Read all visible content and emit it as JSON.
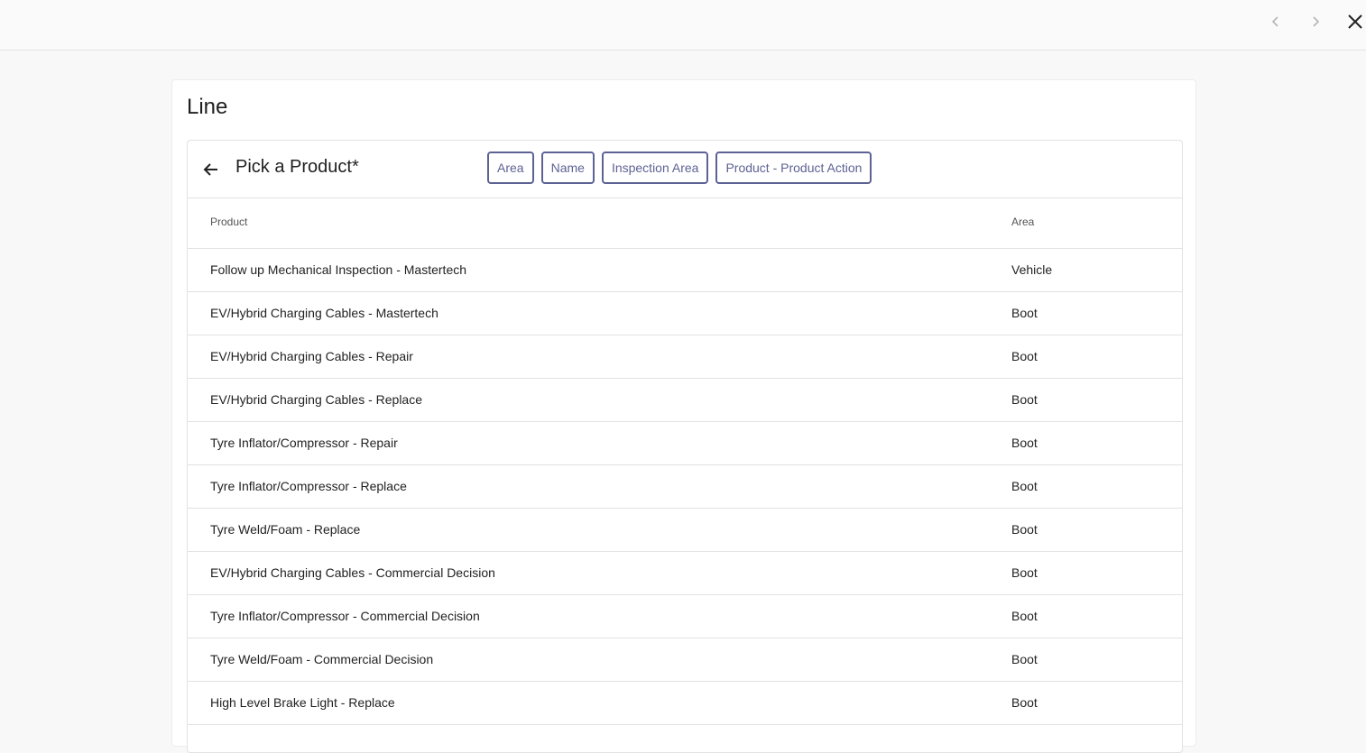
{
  "top_nav": {
    "prev_icon": "chevron-left-icon",
    "next_icon": "chevron-right-icon",
    "close_icon": "close-icon"
  },
  "card": {
    "title": "Line"
  },
  "picker": {
    "back_icon": "arrow-left-icon",
    "title": "Pick a Product*",
    "chips": [
      "Area",
      "Name",
      "Inspection Area",
      "Product - Product Action"
    ],
    "accent_color": "#5d6294"
  },
  "table": {
    "headers": {
      "product": "Product",
      "area": "Area"
    },
    "rows": [
      {
        "product": "Follow up Mechanical Inspection - Mastertech",
        "area": "Vehicle"
      },
      {
        "product": "EV/Hybrid Charging Cables - Mastertech",
        "area": "Boot"
      },
      {
        "product": "EV/Hybrid Charging Cables - Repair",
        "area": "Boot"
      },
      {
        "product": "EV/Hybrid Charging Cables - Replace",
        "area": "Boot"
      },
      {
        "product": "Tyre Inflator/Compressor - Repair",
        "area": "Boot"
      },
      {
        "product": "Tyre Inflator/Compressor - Replace",
        "area": "Boot"
      },
      {
        "product": "Tyre Weld/Foam - Replace",
        "area": "Boot"
      },
      {
        "product": "EV/Hybrid Charging Cables - Commercial Decision",
        "area": "Boot"
      },
      {
        "product": "Tyre Inflator/Compressor - Commercial Decision",
        "area": "Boot"
      },
      {
        "product": "Tyre Weld/Foam - Commercial Decision",
        "area": "Boot"
      },
      {
        "product": "High Level Brake Light - Replace",
        "area": "Boot"
      }
    ]
  }
}
